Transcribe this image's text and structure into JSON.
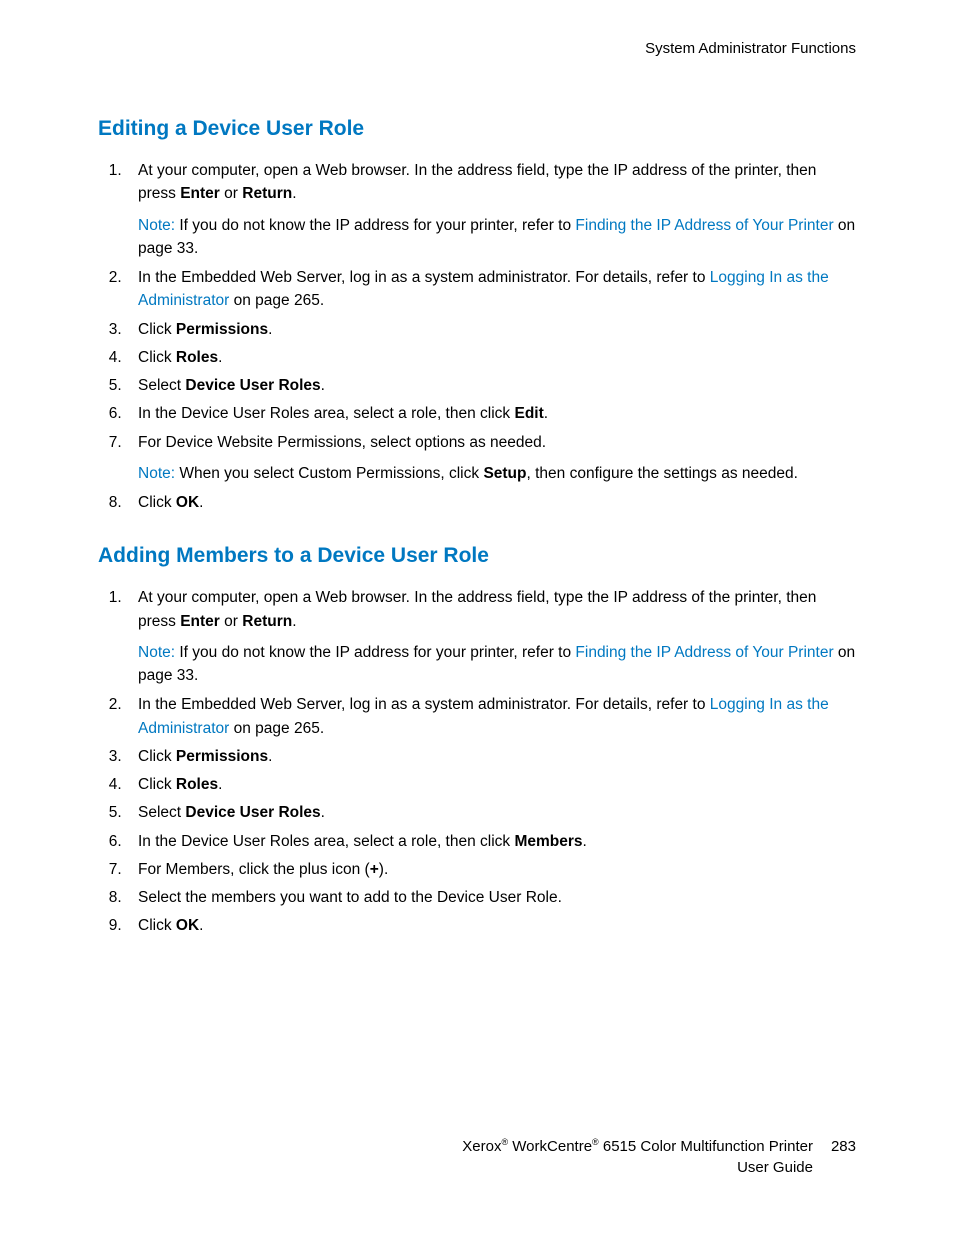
{
  "header": {
    "right_text": "System Administrator Functions"
  },
  "section1": {
    "heading": "Editing a Device User Role",
    "steps": {
      "s1_a": "At your computer, open a Web browser. In the address field, type the IP address of the printer, then press ",
      "s1_b_bold": "Enter",
      "s1_c": " or ",
      "s1_d_bold": "Return",
      "s1_e": ".",
      "s1_note_label": "Note: ",
      "s1_note_a": "If you do not know the IP address for your printer, refer to ",
      "s1_note_link": "Finding the IP Address of Your Printer",
      "s1_note_b": " on page 33.",
      "s2_a": "In the Embedded Web Server, log in as a system administrator. For details, refer to ",
      "s2_link": "Logging In as the Administrator",
      "s2_b": " on page 265.",
      "s3_a": "Click ",
      "s3_bold": "Permissions",
      "s3_b": ".",
      "s4_a": "Click ",
      "s4_bold": "Roles",
      "s4_b": ".",
      "s5_a": "Select ",
      "s5_bold": "Device User Roles",
      "s5_b": ".",
      "s6_a": "In the Device User Roles area, select a role, then click ",
      "s6_bold": "Edit",
      "s6_b": ".",
      "s7_a": "For Device Website Permissions, select options as needed.",
      "s7_note_label": "Note: ",
      "s7_note_a": "When you select Custom Permissions, click ",
      "s7_note_bold": "Setup",
      "s7_note_b": ", then configure the settings as needed.",
      "s8_a": "Click ",
      "s8_bold": "OK",
      "s8_b": "."
    }
  },
  "section2": {
    "heading": "Adding Members to a Device User Role",
    "steps": {
      "s1_a": "At your computer, open a Web browser. In the address field, type the IP address of the printer, then press ",
      "s1_b_bold": "Enter",
      "s1_c": " or ",
      "s1_d_bold": "Return",
      "s1_e": ".",
      "s1_note_label": "Note: ",
      "s1_note_a": "If you do not know the IP address for your printer, refer to ",
      "s1_note_link": "Finding the IP Address of Your Printer",
      "s1_note_b": " on page 33.",
      "s2_a": "In the Embedded Web Server, log in as a system administrator. For details, refer to ",
      "s2_link": "Logging In as the Administrator",
      "s2_b": " on page 265.",
      "s3_a": "Click ",
      "s3_bold": "Permissions",
      "s3_b": ".",
      "s4_a": "Click ",
      "s4_bold": "Roles",
      "s4_b": ".",
      "s5_a": "Select ",
      "s5_bold": "Device User Roles",
      "s5_b": ".",
      "s6_a": "In the Device User Roles area, select a role, then click ",
      "s6_bold": "Members",
      "s6_b": ".",
      "s7_a": "For Members, click the plus icon (",
      "s7_bold": "+",
      "s7_b": ").",
      "s8_a": "Select the members you want to add to the Device User Role.",
      "s9_a": "Click ",
      "s9_bold": "OK",
      "s9_b": "."
    }
  },
  "footer": {
    "product_a": "Xerox",
    "product_b": " WorkCentre",
    "product_c": " 6515 Color Multifunction Printer",
    "guide": "User Guide",
    "page_number": "283"
  }
}
